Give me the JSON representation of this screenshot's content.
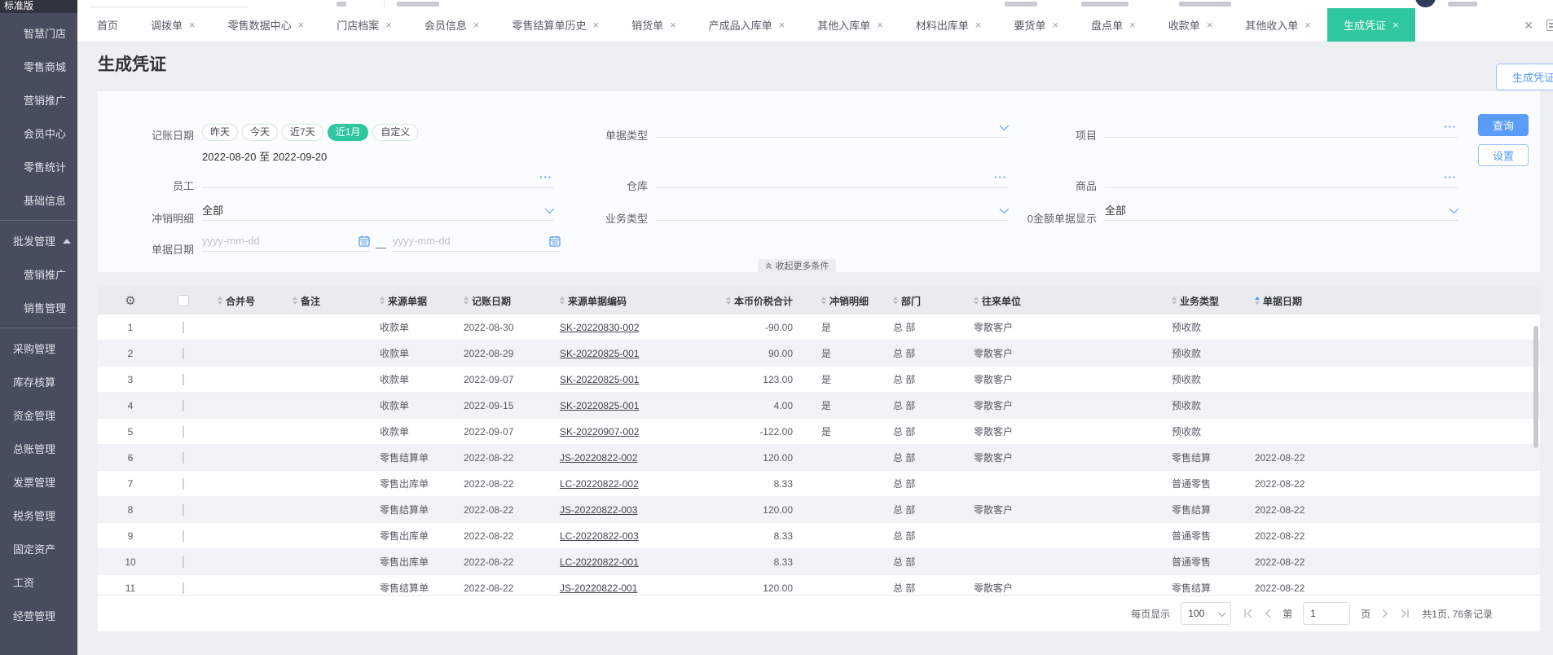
{
  "window": {
    "edition": "标准版"
  },
  "icons": {
    "gear": "⚙",
    "close": "×",
    "close_all": "✕"
  },
  "sidebar": {
    "items": [
      {
        "label": "智慧门店",
        "indent": 1
      },
      {
        "label": "零售商城",
        "indent": 1
      },
      {
        "label": "营销推广",
        "indent": 1
      },
      {
        "label": "会员中心",
        "indent": 1
      },
      {
        "label": "零售统计",
        "indent": 1
      },
      {
        "label": "基础信息",
        "indent": 1
      },
      {
        "label": "批发管理",
        "indent": 0,
        "group": true,
        "expanded": true,
        "divider_before": true
      },
      {
        "label": "营销推广",
        "indent": 1
      },
      {
        "label": "销售管理",
        "indent": 1
      },
      {
        "label": "采购管理",
        "indent": 0,
        "divider_before": true
      },
      {
        "label": "库存核算",
        "indent": 0
      },
      {
        "label": "资金管理",
        "indent": 0
      },
      {
        "label": "总账管理",
        "indent": 0
      },
      {
        "label": "发票管理",
        "indent": 0
      },
      {
        "label": "税务管理",
        "indent": 0
      },
      {
        "label": "固定资产",
        "indent": 0
      },
      {
        "label": "工资",
        "indent": 0
      },
      {
        "label": "经营管理",
        "indent": 0
      }
    ]
  },
  "tabbar": {
    "tabs": [
      {
        "label": "首页",
        "closable": false
      },
      {
        "label": "调拨单",
        "closable": true
      },
      {
        "label": "零售数据中心",
        "closable": true
      },
      {
        "label": "门店档案",
        "closable": true
      },
      {
        "label": "会员信息",
        "closable": true
      },
      {
        "label": "零售结算单历史",
        "closable": true
      },
      {
        "label": "销货单",
        "closable": true
      },
      {
        "label": "产成品入库单",
        "closable": true
      },
      {
        "label": "其他入库单",
        "closable": true
      },
      {
        "label": "材料出库单",
        "closable": true
      },
      {
        "label": "要货单",
        "closable": true
      },
      {
        "label": "盘点单",
        "closable": true
      },
      {
        "label": "收款单",
        "closable": true
      },
      {
        "label": "其他收入单",
        "closable": true
      },
      {
        "label": "生成凭证",
        "closable": true,
        "active": true
      }
    ]
  },
  "page": {
    "title": "生成凭证",
    "action_button": "生成凭证"
  },
  "filters": {
    "accounting_date": {
      "label": "记账日期",
      "presets": [
        "昨天",
        "今天",
        "近7天",
        "近1月",
        "自定义"
      ],
      "active_preset": "近1月",
      "range_text": "2022-08-20 至 2022-09-20"
    },
    "doc_type": {
      "label": "单据类型",
      "value": ""
    },
    "project": {
      "label": "项目",
      "value": ""
    },
    "employee": {
      "label": "员工",
      "value": ""
    },
    "warehouse": {
      "label": "仓库",
      "value": ""
    },
    "goods": {
      "label": "商品",
      "value": ""
    },
    "write_off": {
      "label": "冲销明细",
      "value": "全部"
    },
    "business_type": {
      "label": "业务类型",
      "value": ""
    },
    "zero_amount": {
      "label": "0金额单据显示",
      "value": "全部"
    },
    "doc_date": {
      "label": "单据日期",
      "start_placeholder": "yyyy-mm-dd",
      "end_placeholder": "yyyy-mm-dd",
      "separator": "—"
    },
    "query_button": "查询",
    "settings_button": "设置",
    "collapse_button": "收起更多条件"
  },
  "table": {
    "columns": [
      {
        "key": "merge",
        "label": "合并号"
      },
      {
        "key": "note",
        "label": "备注"
      },
      {
        "key": "source",
        "label": "来源单据"
      },
      {
        "key": "acct_date",
        "label": "记账日期"
      },
      {
        "key": "code",
        "label": "来源单据编码"
      },
      {
        "key": "amount",
        "label": "本币价税合计",
        "align": "right"
      },
      {
        "key": "writeoff",
        "label": "冲销明细"
      },
      {
        "key": "dept",
        "label": "部门"
      },
      {
        "key": "partner",
        "label": "往来单位"
      },
      {
        "key": "biz_type",
        "label": "业务类型"
      },
      {
        "key": "doc_date",
        "label": "单据日期",
        "sorted": "asc"
      }
    ],
    "rows": [
      {
        "no": "1",
        "merge": "",
        "note": "",
        "source": "收款单",
        "acct_date": "2022-08-30",
        "code": "SK-20220830-002",
        "amount": "-90.00",
        "writeoff": "是",
        "dept": "总 部",
        "partner": "零散客户",
        "biz_type": "预收款",
        "doc_date": ""
      },
      {
        "no": "2",
        "merge": "",
        "note": "",
        "source": "收款单",
        "acct_date": "2022-08-29",
        "code": "SK-20220825-001",
        "amount": "90.00",
        "writeoff": "是",
        "dept": "总 部",
        "partner": "零散客户",
        "biz_type": "预收款",
        "doc_date": ""
      },
      {
        "no": "3",
        "merge": "",
        "note": "",
        "source": "收款单",
        "acct_date": "2022-09-07",
        "code": "SK-20220825-001",
        "amount": "123.00",
        "writeoff": "是",
        "dept": "总 部",
        "partner": "零散客户",
        "biz_type": "预收款",
        "doc_date": ""
      },
      {
        "no": "4",
        "merge": "",
        "note": "",
        "source": "收款单",
        "acct_date": "2022-09-15",
        "code": "SK-20220825-001",
        "amount": "4.00",
        "writeoff": "是",
        "dept": "总 部",
        "partner": "零散客户",
        "biz_type": "预收款",
        "doc_date": ""
      },
      {
        "no": "5",
        "merge": "",
        "note": "",
        "source": "收款单",
        "acct_date": "2022-09-07",
        "code": "SK-20220907-002",
        "amount": "-122.00",
        "writeoff": "是",
        "dept": "总 部",
        "partner": "零散客户",
        "biz_type": "预收款",
        "doc_date": ""
      },
      {
        "no": "6",
        "merge": "",
        "note": "",
        "source": "零售结算单",
        "acct_date": "2022-08-22",
        "code": "JS-20220822-002",
        "amount": "120.00",
        "writeoff": "",
        "dept": "总 部",
        "partner": "零散客户",
        "biz_type": "零售结算",
        "doc_date": "2022-08-22"
      },
      {
        "no": "7",
        "merge": "",
        "note": "",
        "source": "零售出库单",
        "acct_date": "2022-08-22",
        "code": "LC-20220822-002",
        "amount": "8.33",
        "writeoff": "",
        "dept": "总 部",
        "partner": "",
        "biz_type": "普通零售",
        "doc_date": "2022-08-22"
      },
      {
        "no": "8",
        "merge": "",
        "note": "",
        "source": "零售结算单",
        "acct_date": "2022-08-22",
        "code": "JS-20220822-003",
        "amount": "120.00",
        "writeoff": "",
        "dept": "总 部",
        "partner": "零散客户",
        "biz_type": "零售结算",
        "doc_date": "2022-08-22"
      },
      {
        "no": "9",
        "merge": "",
        "note": "",
        "source": "零售出库单",
        "acct_date": "2022-08-22",
        "code": "LC-20220822-003",
        "amount": "8.33",
        "writeoff": "",
        "dept": "总 部",
        "partner": "",
        "biz_type": "普通零售",
        "doc_date": "2022-08-22"
      },
      {
        "no": "10",
        "merge": "",
        "note": "",
        "source": "零售出库单",
        "acct_date": "2022-08-22",
        "code": "LC-20220822-001",
        "amount": "8.33",
        "writeoff": "",
        "dept": "总 部",
        "partner": "",
        "biz_type": "普通零售",
        "doc_date": "2022-08-22"
      },
      {
        "no": "11",
        "merge": "",
        "note": "",
        "source": "零售结算单",
        "acct_date": "2022-08-22",
        "code": "JS-20220822-001",
        "amount": "120.00",
        "writeoff": "",
        "dept": "总 部",
        "partner": "零散客户",
        "biz_type": "零售结算",
        "doc_date": "2022-08-22"
      }
    ]
  },
  "pagination": {
    "per_page_label": "每页显示",
    "per_page": "100",
    "page_prefix": "第",
    "page": "1",
    "page_suffix": "页",
    "total_text": "共1页, 76条记录"
  }
}
